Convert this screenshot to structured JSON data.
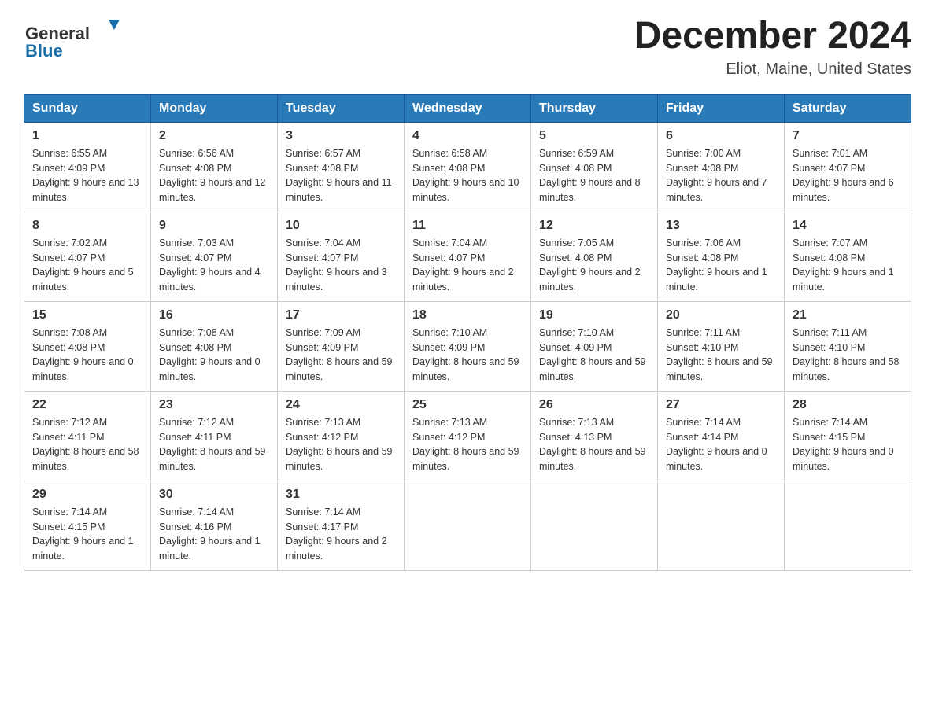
{
  "header": {
    "logo_general": "General",
    "logo_blue": "Blue",
    "month_title": "December 2024",
    "location": "Eliot, Maine, United States"
  },
  "weekdays": [
    "Sunday",
    "Monday",
    "Tuesday",
    "Wednesday",
    "Thursday",
    "Friday",
    "Saturday"
  ],
  "weeks": [
    [
      {
        "day": 1,
        "sunrise": "6:55 AM",
        "sunset": "4:09 PM",
        "daylight": "9 hours and 13 minutes."
      },
      {
        "day": 2,
        "sunrise": "6:56 AM",
        "sunset": "4:08 PM",
        "daylight": "9 hours and 12 minutes."
      },
      {
        "day": 3,
        "sunrise": "6:57 AM",
        "sunset": "4:08 PM",
        "daylight": "9 hours and 11 minutes."
      },
      {
        "day": 4,
        "sunrise": "6:58 AM",
        "sunset": "4:08 PM",
        "daylight": "9 hours and 10 minutes."
      },
      {
        "day": 5,
        "sunrise": "6:59 AM",
        "sunset": "4:08 PM",
        "daylight": "9 hours and 8 minutes."
      },
      {
        "day": 6,
        "sunrise": "7:00 AM",
        "sunset": "4:08 PM",
        "daylight": "9 hours and 7 minutes."
      },
      {
        "day": 7,
        "sunrise": "7:01 AM",
        "sunset": "4:07 PM",
        "daylight": "9 hours and 6 minutes."
      }
    ],
    [
      {
        "day": 8,
        "sunrise": "7:02 AM",
        "sunset": "4:07 PM",
        "daylight": "9 hours and 5 minutes."
      },
      {
        "day": 9,
        "sunrise": "7:03 AM",
        "sunset": "4:07 PM",
        "daylight": "9 hours and 4 minutes."
      },
      {
        "day": 10,
        "sunrise": "7:04 AM",
        "sunset": "4:07 PM",
        "daylight": "9 hours and 3 minutes."
      },
      {
        "day": 11,
        "sunrise": "7:04 AM",
        "sunset": "4:07 PM",
        "daylight": "9 hours and 2 minutes."
      },
      {
        "day": 12,
        "sunrise": "7:05 AM",
        "sunset": "4:08 PM",
        "daylight": "9 hours and 2 minutes."
      },
      {
        "day": 13,
        "sunrise": "7:06 AM",
        "sunset": "4:08 PM",
        "daylight": "9 hours and 1 minute."
      },
      {
        "day": 14,
        "sunrise": "7:07 AM",
        "sunset": "4:08 PM",
        "daylight": "9 hours and 1 minute."
      }
    ],
    [
      {
        "day": 15,
        "sunrise": "7:08 AM",
        "sunset": "4:08 PM",
        "daylight": "9 hours and 0 minutes."
      },
      {
        "day": 16,
        "sunrise": "7:08 AM",
        "sunset": "4:08 PM",
        "daylight": "9 hours and 0 minutes."
      },
      {
        "day": 17,
        "sunrise": "7:09 AM",
        "sunset": "4:09 PM",
        "daylight": "8 hours and 59 minutes."
      },
      {
        "day": 18,
        "sunrise": "7:10 AM",
        "sunset": "4:09 PM",
        "daylight": "8 hours and 59 minutes."
      },
      {
        "day": 19,
        "sunrise": "7:10 AM",
        "sunset": "4:09 PM",
        "daylight": "8 hours and 59 minutes."
      },
      {
        "day": 20,
        "sunrise": "7:11 AM",
        "sunset": "4:10 PM",
        "daylight": "8 hours and 59 minutes."
      },
      {
        "day": 21,
        "sunrise": "7:11 AM",
        "sunset": "4:10 PM",
        "daylight": "8 hours and 58 minutes."
      }
    ],
    [
      {
        "day": 22,
        "sunrise": "7:12 AM",
        "sunset": "4:11 PM",
        "daylight": "8 hours and 58 minutes."
      },
      {
        "day": 23,
        "sunrise": "7:12 AM",
        "sunset": "4:11 PM",
        "daylight": "8 hours and 59 minutes."
      },
      {
        "day": 24,
        "sunrise": "7:13 AM",
        "sunset": "4:12 PM",
        "daylight": "8 hours and 59 minutes."
      },
      {
        "day": 25,
        "sunrise": "7:13 AM",
        "sunset": "4:12 PM",
        "daylight": "8 hours and 59 minutes."
      },
      {
        "day": 26,
        "sunrise": "7:13 AM",
        "sunset": "4:13 PM",
        "daylight": "8 hours and 59 minutes."
      },
      {
        "day": 27,
        "sunrise": "7:14 AM",
        "sunset": "4:14 PM",
        "daylight": "9 hours and 0 minutes."
      },
      {
        "day": 28,
        "sunrise": "7:14 AM",
        "sunset": "4:15 PM",
        "daylight": "9 hours and 0 minutes."
      }
    ],
    [
      {
        "day": 29,
        "sunrise": "7:14 AM",
        "sunset": "4:15 PM",
        "daylight": "9 hours and 1 minute."
      },
      {
        "day": 30,
        "sunrise": "7:14 AM",
        "sunset": "4:16 PM",
        "daylight": "9 hours and 1 minute."
      },
      {
        "day": 31,
        "sunrise": "7:14 AM",
        "sunset": "4:17 PM",
        "daylight": "9 hours and 2 minutes."
      },
      null,
      null,
      null,
      null
    ]
  ]
}
